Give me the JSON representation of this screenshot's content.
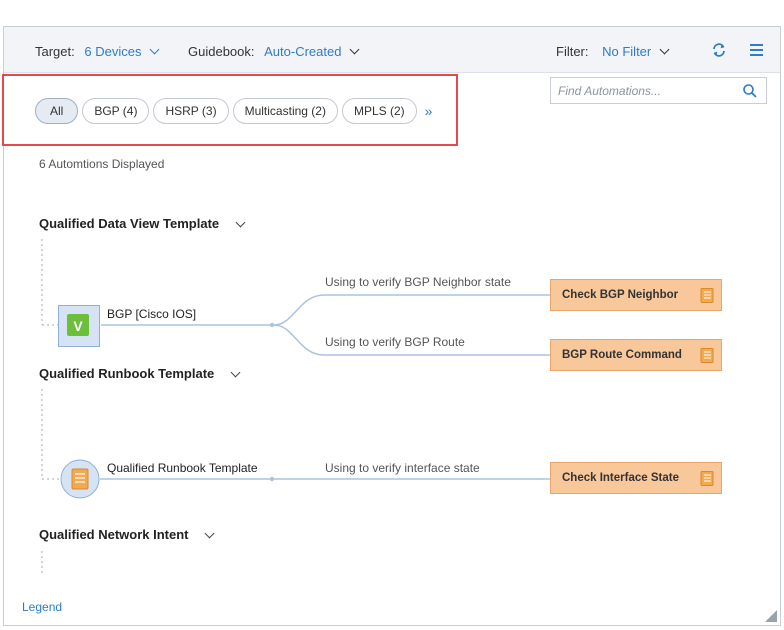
{
  "topbar": {
    "target_label": "Target:",
    "target_value": "6 Devices",
    "guidebook_label": "Guidebook:",
    "guidebook_value": "Auto-Created",
    "filter_label": "Filter:",
    "filter_value": "No Filter",
    "refresh_icon": "refresh-icon",
    "menu_icon": "hamburger-menu-icon"
  },
  "search": {
    "placeholder": "Find Automations..."
  },
  "filters": [
    {
      "label": "All",
      "active": true
    },
    {
      "label": "BGP (4)",
      "active": false
    },
    {
      "label": "HSRP (3)",
      "active": false
    },
    {
      "label": "Multicasting (2)",
      "active": false
    },
    {
      "label": "MPLS (2)",
      "active": false
    }
  ],
  "more_icon": "double-chevron-right-icon",
  "count_text": "6 Automtions Displayed",
  "sections": {
    "data_view": {
      "title": "Qualified Data View Template",
      "node_label": "BGP [Cisco IOS]",
      "node_icon_letter": "V",
      "links": [
        {
          "label": "Using to verify BGP Neighbor state",
          "action": "Check BGP Neighbor"
        },
        {
          "label": "Using to verify BGP Route",
          "action": "BGP Route Command"
        }
      ]
    },
    "runbook": {
      "title": "Qualified Runbook Template",
      "node_label": "Qualified Runbook Template",
      "links": [
        {
          "label": "Using to verify interface state",
          "action": "Check Interface State"
        }
      ]
    },
    "intent": {
      "title": "Qualified Network Intent"
    }
  },
  "legend_label": "Legend",
  "colors": {
    "accent": "#2f7bc8",
    "highlight": "#e5484d",
    "action_fill": "#f8c79a",
    "data_view_icon": "#6bbf3a"
  }
}
